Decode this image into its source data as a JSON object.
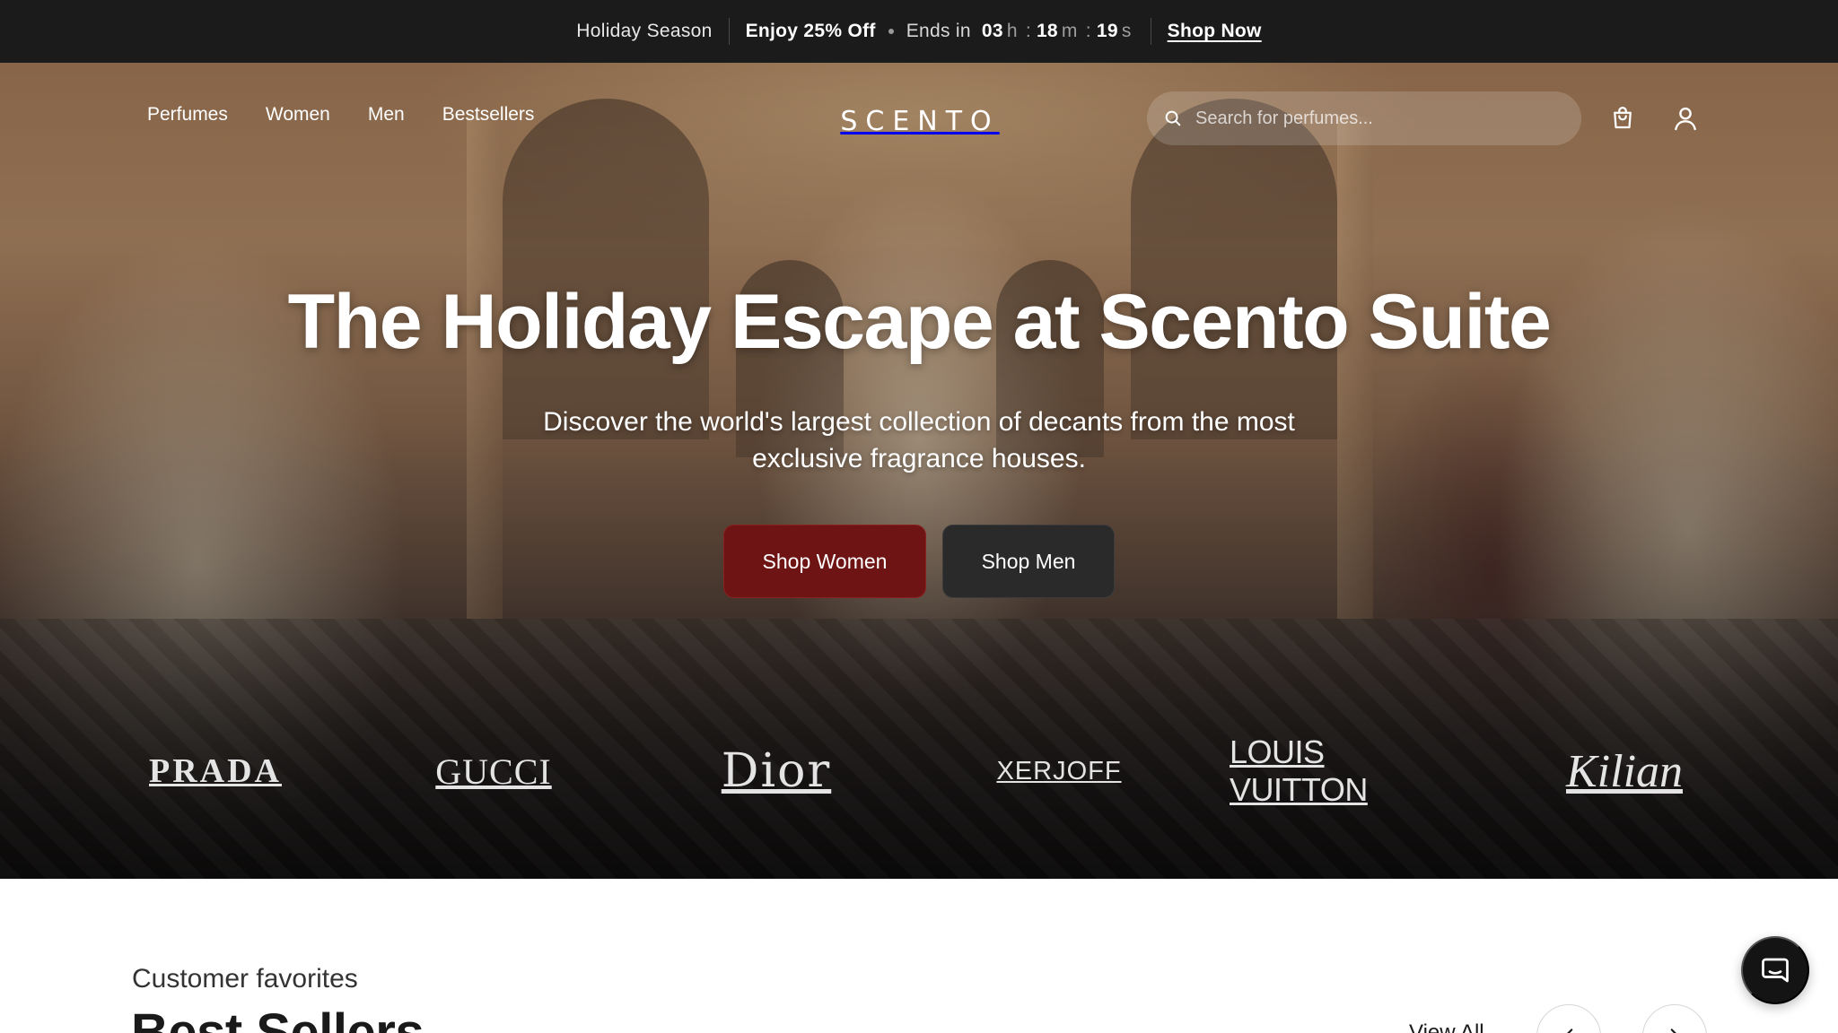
{
  "promo": {
    "season": "Holiday Season",
    "offer": "Enjoy 25% Off",
    "ends_label": "Ends in",
    "hours": "03",
    "hours_unit": "h",
    "minutes": "18",
    "minutes_unit": "m",
    "seconds": "19",
    "seconds_unit": "s",
    "cta": "Shop Now"
  },
  "nav": {
    "links": [
      "Perfumes",
      "Women",
      "Men",
      "Bestsellers"
    ],
    "logo": "SCENTO",
    "search_placeholder": "Search for perfumes...",
    "icons": [
      "search-icon",
      "shopping-bag-icon",
      "user-icon"
    ]
  },
  "hero": {
    "headline": "The Holiday Escape at Scento Suite",
    "subheadline": "Discover the world's largest collection of decants from the most exclusive fragrance houses.",
    "cta_women": "Shop Women",
    "cta_men": "Shop Men",
    "colors": {
      "women_button": "#6e1414",
      "men_button": "#2a2a2a",
      "promo_bar": "#1b1b1b"
    }
  },
  "brands": [
    "PRADA",
    "GUCCI",
    "Dior",
    "XERJOFF",
    "LOUIS VUITTON",
    "Kilian"
  ],
  "bestsellers": {
    "kicker": "Customer favorites",
    "title": "Best Sellers",
    "view_all": "View All",
    "icons": [
      "chevron-left-icon",
      "chevron-right-icon"
    ]
  },
  "chat": {
    "icon": "chat-icon"
  }
}
